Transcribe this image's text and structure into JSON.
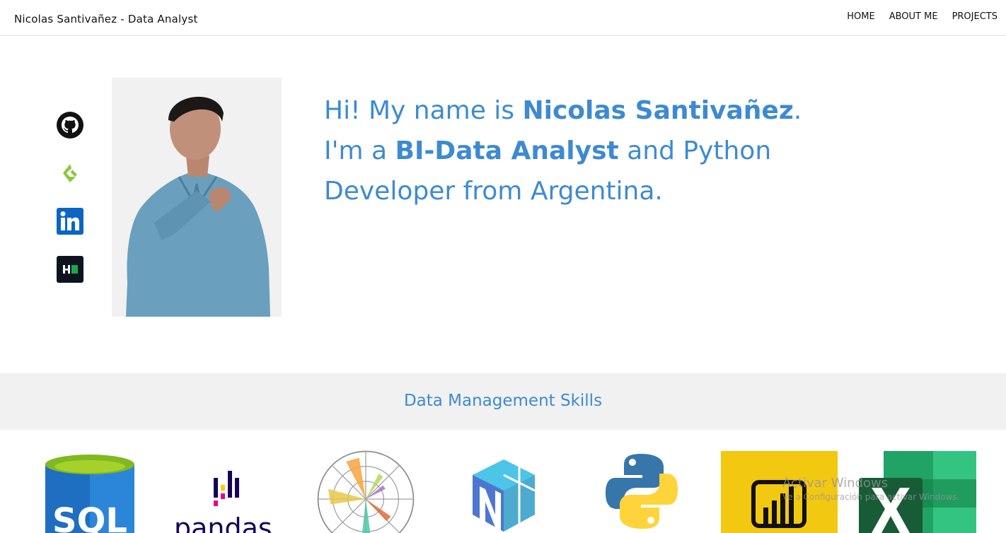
{
  "navbar": {
    "brand": "Nicolas Santivañez - Data Analyst",
    "links": [
      "HOME",
      "ABOUT ME",
      "PROJECTS"
    ]
  },
  "social": {
    "icons": [
      "github-icon",
      "kaggle-icon",
      "linkedin-icon",
      "hackerrank-icon"
    ]
  },
  "intro": {
    "part1": "Hi! My name is ",
    "name": "Nicolas Santivañez",
    "part2": ".",
    "part3": "I'm a ",
    "role": "BI-Data Analyst",
    "part4": " and Python",
    "part5": "Developer from Argentina."
  },
  "skills": {
    "title": "Data Management Skills",
    "logos": [
      "sql-icon",
      "pandas-icon",
      "matplotlib-icon",
      "numpy-icon",
      "python-icon",
      "powerbi-icon",
      "excel-icon"
    ],
    "sql_text": "SQL",
    "pandas_text": "pandas"
  },
  "watermark": {
    "title": "Activar Windows",
    "subtitle": "Ve a Configuración para activar Windows."
  },
  "colors": {
    "accent": "#3d8ad2",
    "band": "#f1f1f1"
  }
}
